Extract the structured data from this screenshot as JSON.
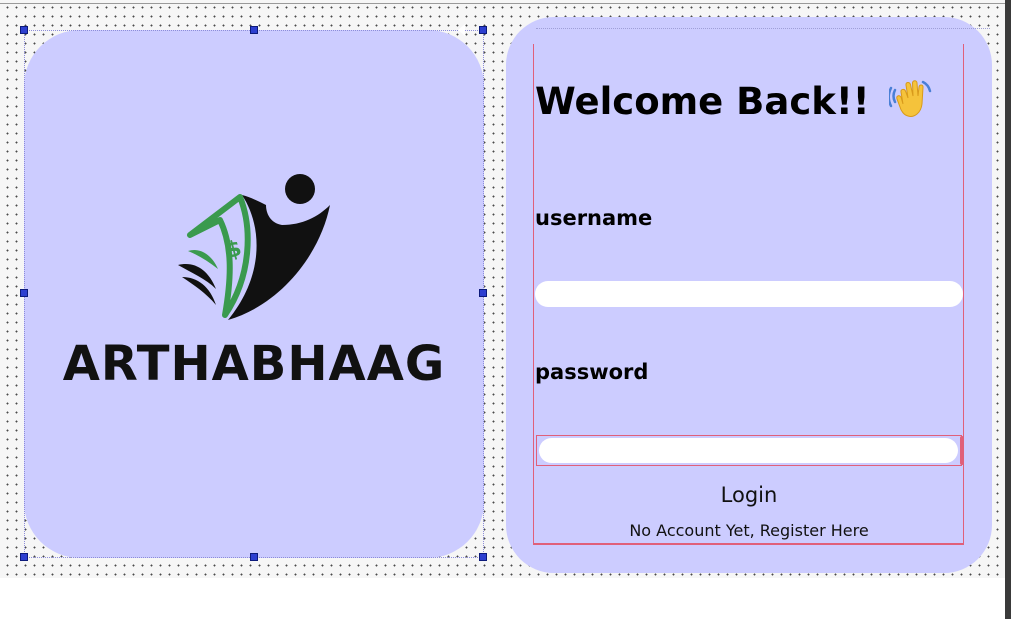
{
  "logo": {
    "wordmark": "ARTHABHAAG",
    "icon": "arthabhaag-logo-icon",
    "colors": {
      "dark": "#111111",
      "green": "#3a9a4e"
    }
  },
  "login": {
    "title": "Welcome Back!!",
    "title_icon": "waving-hand-icon",
    "username_label": "username",
    "username_value": "",
    "password_label": "password",
    "password_value": "",
    "login_button": "Login",
    "register_link": "No Account Yet, Register Here"
  },
  "theme": {
    "panel_bg": "#ccccff",
    "field_bg": "#ffffff",
    "selection_border": "#e0607a",
    "handle": "#2d3fd0"
  }
}
